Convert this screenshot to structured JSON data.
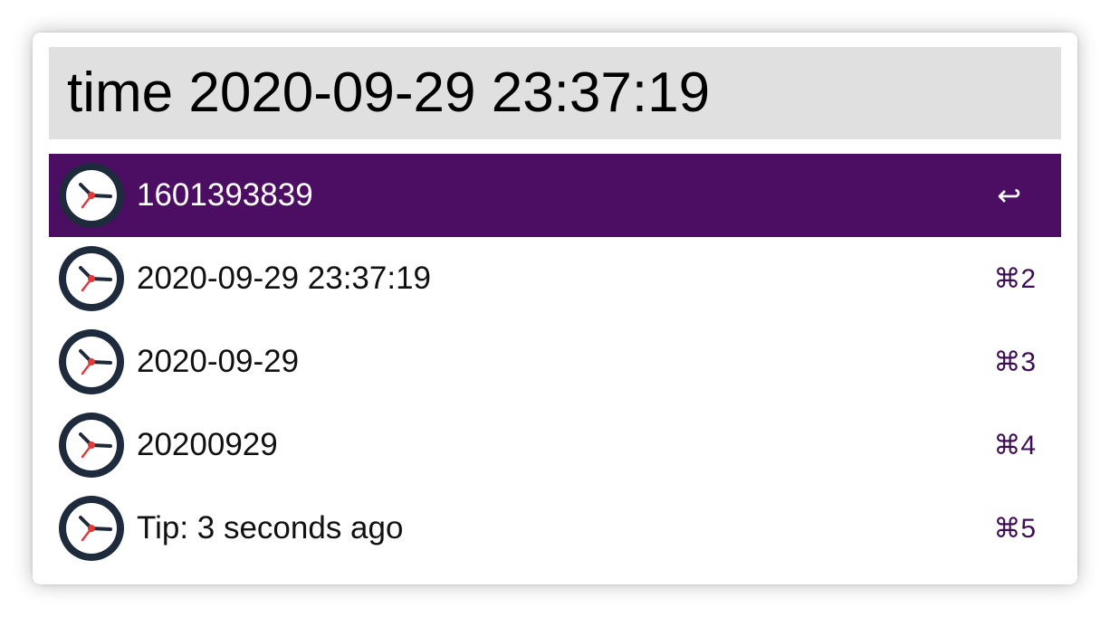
{
  "search": {
    "query": "time 2020-09-29 23:37:19"
  },
  "results": [
    {
      "label": "1601393839",
      "shortcut": "↩",
      "icon": "clock-icon",
      "selected": true
    },
    {
      "label": "2020-09-29 23:37:19",
      "shortcut": "⌘2",
      "icon": "clock-icon",
      "selected": false
    },
    {
      "label": "2020-09-29",
      "shortcut": "⌘3",
      "icon": "clock-icon",
      "selected": false
    },
    {
      "label": "20200929",
      "shortcut": "⌘4",
      "icon": "clock-icon",
      "selected": false
    },
    {
      "label": "Tip: 3 seconds ago",
      "shortcut": "⌘5",
      "icon": "clock-icon",
      "selected": false
    }
  ],
  "colors": {
    "selected_row": "#4c0e62",
    "search_background": "#e0e0e0",
    "shortcut_text": "#3d0f52",
    "clock_rim": "#1e2b3c",
    "clock_second_hand": "#e03a3a"
  }
}
